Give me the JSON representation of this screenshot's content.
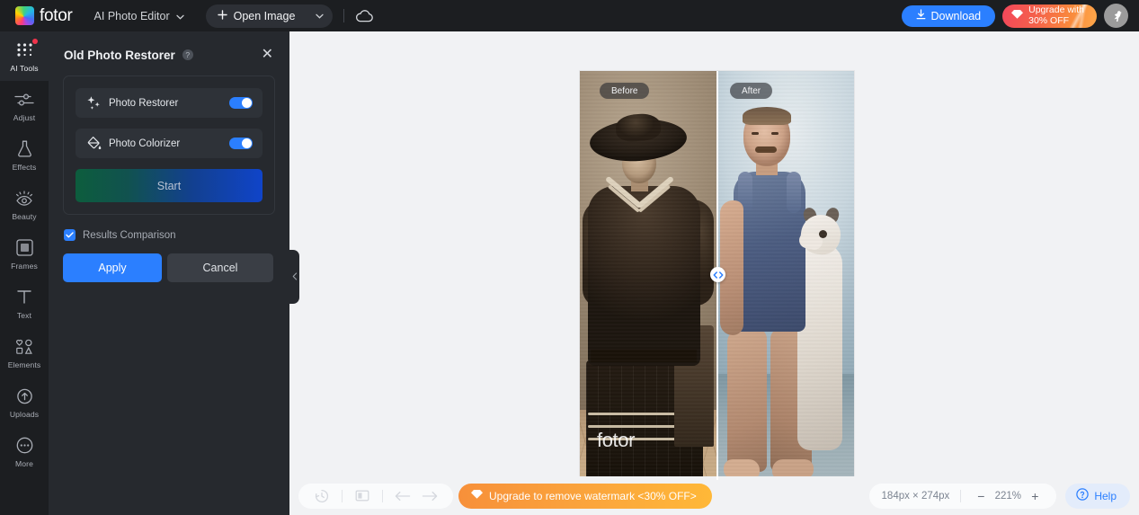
{
  "header": {
    "brand": "fotor",
    "mode_label": "AI Photo Editor",
    "open_image_label": "Open Image",
    "download_label": "Download",
    "upgrade_line1": "Upgrade with",
    "upgrade_line2": "30% OFF",
    "icons": {
      "plus": "plus-icon",
      "chevron": "chevron-down-icon",
      "cloud": "cloud-icon",
      "download": "download-icon",
      "diamond": "diamond-icon",
      "avatar": "user-avatar"
    },
    "colors": {
      "bar_bg": "#1c1e21",
      "download_blue": "#2b7fff"
    }
  },
  "sidebar": {
    "items": [
      {
        "label": "AI Tools",
        "icon": "grid-dots-icon",
        "active": true,
        "badge": true
      },
      {
        "label": "Adjust",
        "icon": "sliders-icon",
        "active": false,
        "badge": false
      },
      {
        "label": "Effects",
        "icon": "flask-icon",
        "active": false,
        "badge": false
      },
      {
        "label": "Beauty",
        "icon": "eye-icon",
        "active": false,
        "badge": false
      },
      {
        "label": "Frames",
        "icon": "frame-icon",
        "active": false,
        "badge": false
      },
      {
        "label": "Text",
        "icon": "text-t-icon",
        "active": false,
        "badge": false
      },
      {
        "label": "Elements",
        "icon": "shapes-icon",
        "active": false,
        "badge": false
      },
      {
        "label": "Uploads",
        "icon": "upload-cloud-icon",
        "active": false,
        "badge": false
      },
      {
        "label": "More",
        "icon": "ellipsis-icon",
        "active": false,
        "badge": false
      }
    ]
  },
  "panel": {
    "title": "Old Photo Restorer",
    "help_glyph": "?",
    "close_glyph": "✕",
    "tools": [
      {
        "label": "Photo Restorer",
        "icon": "sparkle-icon",
        "enabled": true
      },
      {
        "label": "Photo Colorizer",
        "icon": "paint-bucket-icon",
        "enabled": true
      }
    ],
    "start_label": "Start",
    "comparison_label": "Results Comparison",
    "comparison_checked": true,
    "apply_label": "Apply",
    "cancel_label": "Cancel",
    "colors": {
      "panel_bg": "#26292e",
      "accent": "#2b7fff"
    }
  },
  "canvas": {
    "collapse_icon": "chevron-left-icon",
    "before_label": "Before",
    "after_label": "After",
    "watermark": "fotor",
    "drag_handle_icon": "left-right-arrows-icon",
    "background_color": "#f1f2f4"
  },
  "bottombar": {
    "history_icon": "history-clock-icon",
    "compare_icon": "compare-split-icon",
    "undo_icon": "undo-arrow-icon",
    "redo_icon": "redo-arrow-icon",
    "watermark_button": "Upgrade to remove watermark <30% OFF>",
    "dimensions": "184px × 274px",
    "zoom_out_glyph": "−",
    "zoom_value": "221%",
    "zoom_in_glyph": "+",
    "help_label": "Help",
    "help_icon": "question-circle-icon",
    "colors": {
      "watermark_orange": "#fba63c",
      "help_blue": "#2b7fff"
    }
  }
}
